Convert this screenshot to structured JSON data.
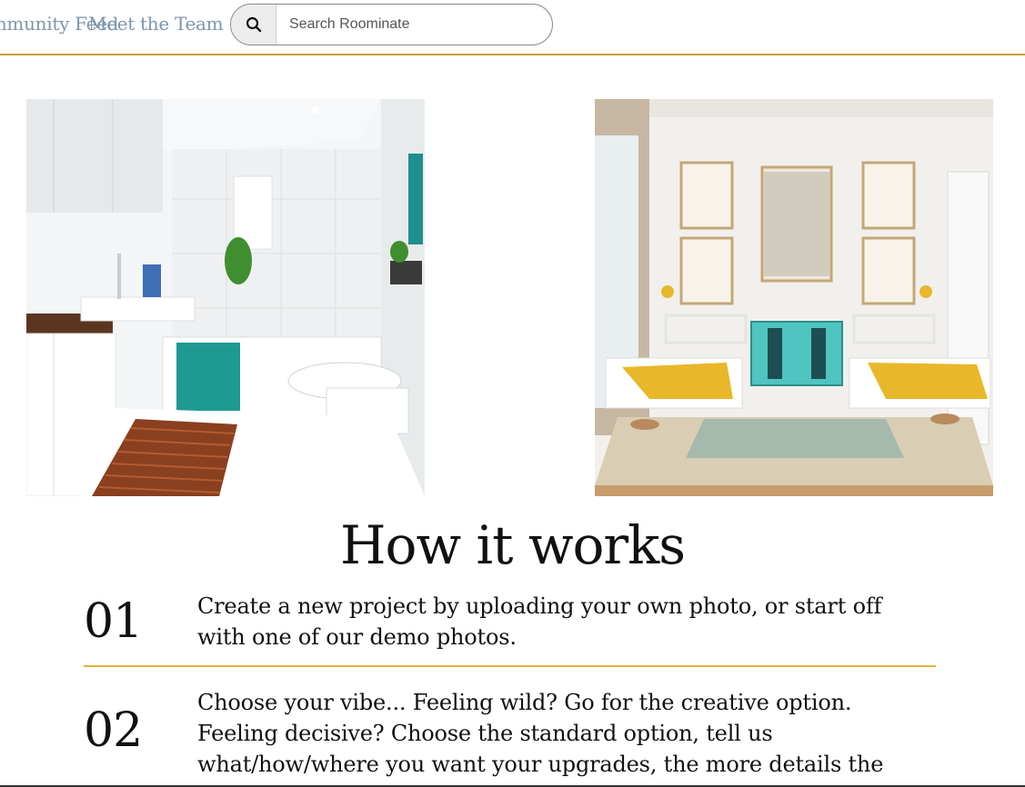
{
  "nav": {
    "community_label": "Community Feed",
    "team_label": "Meet the Team"
  },
  "search": {
    "placeholder": "Search Roominate",
    "icon": "search-icon"
  },
  "images": [
    {
      "name": "bathroom-photo"
    },
    {
      "name": "kids-bedroom-photo"
    }
  ],
  "how_it_works": {
    "title": "How it works",
    "steps": [
      {
        "number": "01",
        "text": "Create a new project by uploading your own photo, or start off with one of our demo photos."
      },
      {
        "number": "02",
        "text": "Choose your vibe... Feeling wild? Go for the creative option. Feeling decisive? Choose the standard option, tell us what/how/where you want your upgrades, the more details the better!"
      }
    ]
  },
  "colors": {
    "accent_gold": "#c9a227",
    "divider_gold": "#e3b53a",
    "nav_link": "#7b97ad"
  }
}
